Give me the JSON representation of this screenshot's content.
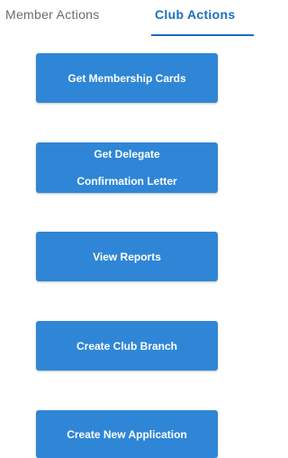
{
  "tabs": {
    "member_label": "Member Actions",
    "club_label": "Club Actions"
  },
  "buttons": {
    "membership_cards": "Get Membership Cards",
    "delegate_line1": "Get Delegate",
    "delegate_line2": "Confirmation Letter",
    "view_reports": "View Reports",
    "create_branch": "Create Club Branch",
    "new_application": "Create New Application"
  },
  "colors": {
    "accent": "#1b6fbf",
    "button": "#2f86d6",
    "inactive_tab": "#6b6b6b"
  }
}
